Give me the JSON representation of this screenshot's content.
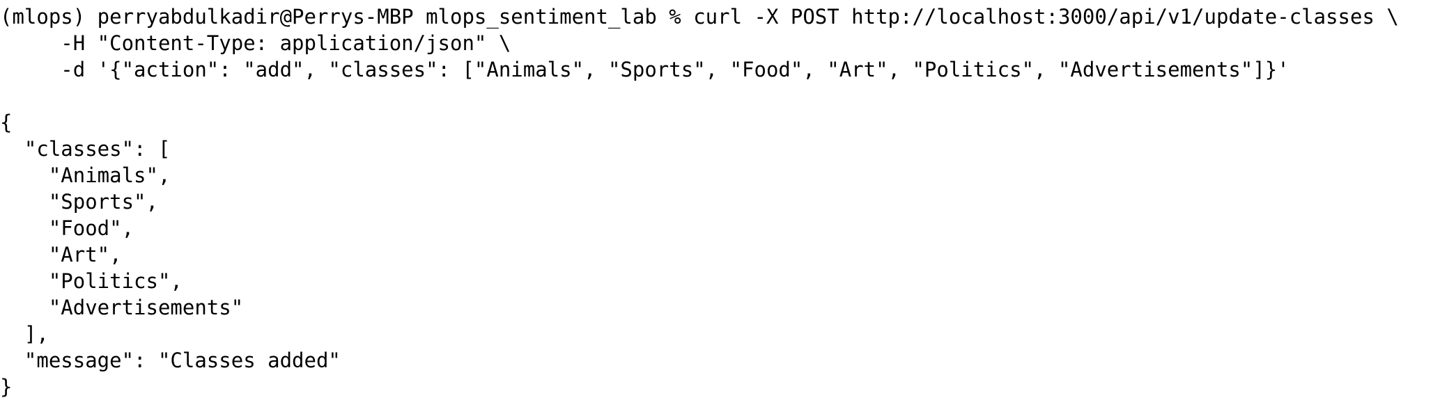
{
  "terminal": {
    "lines": [
      "(mlops) perryabdulkadir@Perrys-MBP mlops_sentiment_lab % curl -X POST http://localhost:3000/api/v1/update-classes \\",
      "     -H \"Content-Type: application/json\" \\",
      "     -d '{\"action\": \"add\", \"classes\": [\"Animals\", \"Sports\", \"Food\", \"Art\", \"Politics\", \"Advertisements\"]}'",
      "",
      "{",
      "  \"classes\": [",
      "    \"Animals\",",
      "    \"Sports\",",
      "    \"Food\",",
      "    \"Art\",",
      "    \"Politics\",",
      "    \"Advertisements\"",
      "  ],",
      "  \"message\": \"Classes added\"",
      "}"
    ]
  }
}
